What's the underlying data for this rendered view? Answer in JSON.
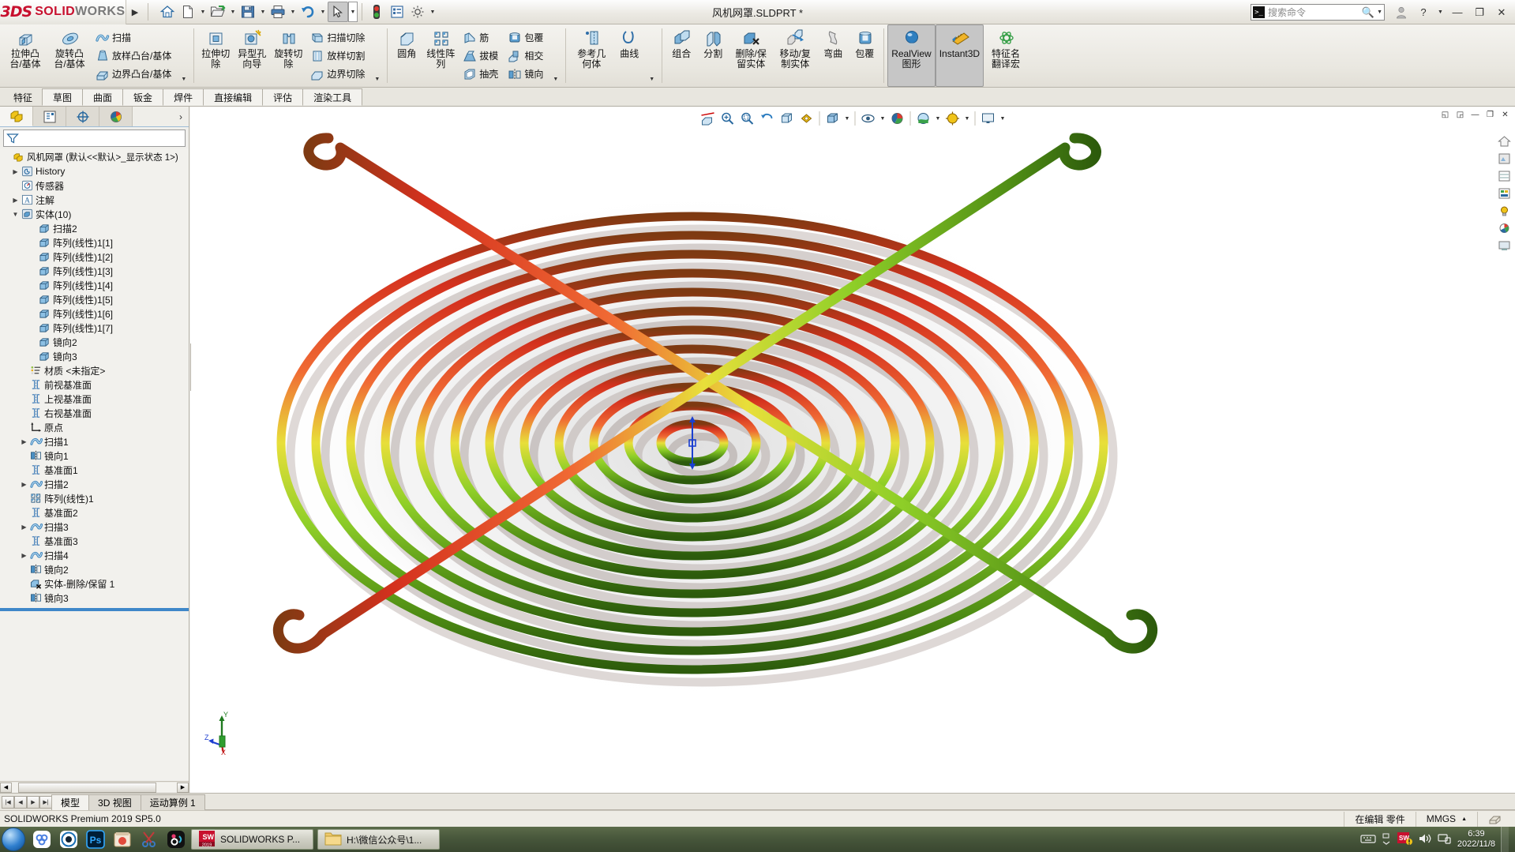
{
  "titlebar": {
    "logo_3ds": "3DS",
    "logo_solid": "SOLID",
    "logo_works": "WORKS",
    "document_title": "风机网罩.SLDPRT *",
    "quick_access": [
      {
        "name": "home-icon",
        "label": "主页"
      },
      {
        "name": "new-document-icon",
        "label": "新建"
      },
      {
        "name": "open-folder-icon",
        "label": "打开"
      },
      {
        "name": "save-icon",
        "label": "保存"
      },
      {
        "name": "print-icon",
        "label": "打印"
      },
      {
        "name": "undo-icon",
        "label": "撤销"
      },
      {
        "name": "select-cursor-icon",
        "label": "选择"
      },
      {
        "name": "rebuild-icon",
        "label": "重建模型"
      },
      {
        "name": "file-properties-icon",
        "label": "文件属性"
      },
      {
        "name": "options-gear-icon",
        "label": "选项"
      }
    ],
    "search": {
      "placeholder": "搜索命令",
      "icon": "search-icon"
    },
    "window_controls": {
      "account": "account-icon",
      "help": "?",
      "minimize": "—",
      "restore": "❐",
      "close": "✕"
    }
  },
  "ribbon": {
    "groups": [
      {
        "id": "boss",
        "big": [
          {
            "label": "拉伸凸\n台/基体",
            "icon": "extrude-boss-icon",
            "dropdown": false
          },
          {
            "label": "旋转凸\n台/基体",
            "icon": "revolve-boss-icon",
            "dropdown": false
          }
        ],
        "small": [
          {
            "label": "扫描",
            "icon": "sweep-icon"
          },
          {
            "label": "放样凸台/基体",
            "icon": "loft-boss-icon"
          },
          {
            "label": "边界凸台/基体",
            "icon": "boundary-boss-icon"
          }
        ],
        "has_drop": true
      },
      {
        "id": "cut",
        "big": [
          {
            "label": "拉伸切\n除",
            "icon": "extrude-cut-icon"
          },
          {
            "label": "异型孔\n向导",
            "icon": "hole-wizard-icon"
          },
          {
            "label": "旋转切\n除",
            "icon": "revolve-cut-icon"
          }
        ],
        "small": [
          {
            "label": "扫描切除",
            "icon": "sweep-cut-icon"
          },
          {
            "label": "放样切割",
            "icon": "loft-cut-icon"
          },
          {
            "label": "边界切除",
            "icon": "boundary-cut-icon"
          }
        ],
        "has_drop": true
      },
      {
        "id": "features",
        "big": [
          {
            "label": "圆角",
            "icon": "fillet-icon"
          },
          {
            "label": "线性阵\n列",
            "icon": "linear-pattern-icon"
          }
        ],
        "small": [
          {
            "label": "筋",
            "icon": "rib-icon"
          },
          {
            "label": "拔模",
            "icon": "draft-icon"
          },
          {
            "label": "抽壳",
            "icon": "shell-icon"
          },
          {
            "label": "包覆",
            "icon": "wrap-icon"
          },
          {
            "label": "相交",
            "icon": "intersect-icon"
          },
          {
            "label": "镜向",
            "icon": "mirror-icon"
          }
        ],
        "has_drop": true
      },
      {
        "id": "reference",
        "big": [
          {
            "label": "参考几\n何体",
            "icon": "reference-geometry-icon"
          },
          {
            "label": "曲线",
            "icon": "curves-icon"
          }
        ],
        "has_drop": true
      },
      {
        "id": "bodies",
        "big": [
          {
            "label": "组合",
            "icon": "combine-icon"
          },
          {
            "label": "分割",
            "icon": "split-icon"
          },
          {
            "label": "删除/保\n留实体",
            "icon": "delete-keep-body-icon"
          },
          {
            "label": "移动/复\n制实体",
            "icon": "move-copy-body-icon"
          },
          {
            "label": "弯曲",
            "icon": "flex-icon"
          },
          {
            "label": "包覆",
            "icon": "wrap2-icon"
          }
        ]
      },
      {
        "id": "display",
        "big": [
          {
            "label": "RealView\n图形",
            "icon": "realview-icon",
            "active": true
          },
          {
            "label": "Instant3D",
            "icon": "instant3d-icon",
            "active": true
          },
          {
            "label": "特征名\n翻译宏",
            "icon": "feature-translate-icon"
          }
        ]
      }
    ]
  },
  "command_tabs": [
    {
      "label": "特征",
      "selected": true
    },
    {
      "label": "草图",
      "selected": false
    },
    {
      "label": "曲面",
      "selected": false
    },
    {
      "label": "钣金",
      "selected": false
    },
    {
      "label": "焊件",
      "selected": false
    },
    {
      "label": "直接编辑",
      "selected": false
    },
    {
      "label": "评估",
      "selected": false
    },
    {
      "label": "渲染工具",
      "selected": false
    }
  ],
  "tree_panel": {
    "tabs": [
      {
        "name": "feature-manager-tab",
        "icon": "feature-tree-icon",
        "selected": true
      },
      {
        "name": "property-manager-tab",
        "icon": "property-manager-icon",
        "selected": false
      },
      {
        "name": "configuration-manager-tab",
        "icon": "configuration-icon",
        "selected": false
      },
      {
        "name": "display-manager-tab",
        "icon": "display-manager-icon",
        "selected": false
      }
    ],
    "more": "›",
    "filter": {
      "icon": "filter-icon",
      "placeholder": ""
    },
    "root": {
      "label": "风机网罩  (默认<<默认>_显示状态 1>)",
      "icon": "part-icon"
    },
    "nodes": [
      {
        "label": "History",
        "icon": "history-icon",
        "indent": 1,
        "expand": "collapsed"
      },
      {
        "label": "传感器",
        "icon": "sensor-icon",
        "indent": 1,
        "expand": "none"
      },
      {
        "label": "注解",
        "icon": "annotations-icon",
        "indent": 1,
        "expand": "collapsed"
      },
      {
        "label": "实体(10)",
        "icon": "solid-bodies-icon",
        "indent": 1,
        "expand": "expanded"
      },
      {
        "label": "扫描2",
        "icon": "body-icon",
        "indent": 3,
        "expand": "none"
      },
      {
        "label": "阵列(线性)1[1]",
        "icon": "body-icon",
        "indent": 3,
        "expand": "none"
      },
      {
        "label": "阵列(线性)1[2]",
        "icon": "body-icon",
        "indent": 3,
        "expand": "none"
      },
      {
        "label": "阵列(线性)1[3]",
        "icon": "body-icon",
        "indent": 3,
        "expand": "none"
      },
      {
        "label": "阵列(线性)1[4]",
        "icon": "body-icon",
        "indent": 3,
        "expand": "none"
      },
      {
        "label": "阵列(线性)1[5]",
        "icon": "body-icon",
        "indent": 3,
        "expand": "none"
      },
      {
        "label": "阵列(线性)1[6]",
        "icon": "body-icon",
        "indent": 3,
        "expand": "none"
      },
      {
        "label": "阵列(线性)1[7]",
        "icon": "body-icon",
        "indent": 3,
        "expand": "none"
      },
      {
        "label": "镜向2",
        "icon": "body-icon",
        "indent": 3,
        "expand": "none"
      },
      {
        "label": "镜向3",
        "icon": "body-icon",
        "indent": 3,
        "expand": "none"
      },
      {
        "label": "材质 <未指定>",
        "icon": "material-icon",
        "indent": 2,
        "expand": "none"
      },
      {
        "label": "前视基准面",
        "icon": "plane-icon",
        "indent": 2,
        "expand": "none"
      },
      {
        "label": "上视基准面",
        "icon": "plane-icon",
        "indent": 2,
        "expand": "none"
      },
      {
        "label": "右视基准面",
        "icon": "plane-icon",
        "indent": 2,
        "expand": "none"
      },
      {
        "label": "原点",
        "icon": "origin-icon",
        "indent": 2,
        "expand": "none"
      },
      {
        "label": "扫描1",
        "icon": "sweep-feature-icon",
        "indent": 2,
        "expand": "collapsed"
      },
      {
        "label": "镜向1",
        "icon": "mirror-feature-icon",
        "indent": 2,
        "expand": "none"
      },
      {
        "label": "基准面1",
        "icon": "plane-icon",
        "indent": 2,
        "expand": "none"
      },
      {
        "label": "扫描2",
        "icon": "sweep-feature-icon",
        "indent": 2,
        "expand": "collapsed"
      },
      {
        "label": "阵列(线性)1",
        "icon": "linear-pattern-feature-icon",
        "indent": 2,
        "expand": "none"
      },
      {
        "label": "基准面2",
        "icon": "plane-icon",
        "indent": 2,
        "expand": "none"
      },
      {
        "label": "扫描3",
        "icon": "sweep-feature-icon",
        "indent": 2,
        "expand": "collapsed"
      },
      {
        "label": "基准面3",
        "icon": "plane-icon",
        "indent": 2,
        "expand": "none"
      },
      {
        "label": "扫描4",
        "icon": "sweep-feature-icon",
        "indent": 2,
        "expand": "collapsed"
      },
      {
        "label": "镜向2",
        "icon": "mirror-feature-icon",
        "indent": 2,
        "expand": "none"
      },
      {
        "label": "实体-删除/保留 1",
        "icon": "delete-body-feature-icon",
        "indent": 2,
        "expand": "none"
      },
      {
        "label": "镜向3",
        "icon": "mirror-feature-icon",
        "indent": 2,
        "expand": "none"
      }
    ]
  },
  "viewport": {
    "toolbar": [
      {
        "name": "section-view-icon"
      },
      {
        "name": "zoom-to-fit-icon"
      },
      {
        "name": "zoom-to-area-icon"
      },
      {
        "name": "previous-view-icon"
      },
      {
        "name": "view-orientation-icon"
      },
      {
        "name": "view-settings-icon"
      },
      {
        "name": "display-style-icon",
        "dropdown": true
      },
      {
        "name": "hide-show-items-icon",
        "dropdown": true
      },
      {
        "name": "edit-appearance-icon"
      },
      {
        "name": "apply-scene-icon",
        "dropdown": true
      },
      {
        "name": "view-setting-icon",
        "dropdown": true
      },
      {
        "name": "viewport-layout-icon",
        "dropdown": true
      }
    ],
    "window_buttons": [
      "◱",
      "◲",
      "—",
      "❐",
      "✕"
    ],
    "right_rail": [
      {
        "name": "view-home-icon"
      },
      {
        "name": "appearance-icon"
      },
      {
        "name": "scene-icon"
      },
      {
        "name": "decal-icon"
      },
      {
        "name": "light-icon"
      },
      {
        "name": "camera-icon"
      },
      {
        "name": "walkthrough-icon"
      }
    ],
    "triad": {
      "x": "X",
      "y": "Y",
      "z": "Z"
    },
    "model_name": "风机网罩"
  },
  "document_tabs": {
    "nav": [
      "|◀",
      "◀",
      "▶",
      "▶|"
    ],
    "tabs": [
      {
        "label": "模型",
        "selected": true
      },
      {
        "label": "3D 视图",
        "selected": false
      },
      {
        "label": "运动算例 1",
        "selected": false
      }
    ]
  },
  "statusbar": {
    "left": "SOLIDWORKS Premium 2019 SP5.0",
    "edit_state": "在编辑 零件",
    "units": "MMGS",
    "units_arrow": "▲",
    "overlay_icon": "custom-icon"
  },
  "taskbar": {
    "start": "start-orb-icon",
    "pinned": [
      {
        "name": "app-icon-1",
        "label": ""
      },
      {
        "name": "app-icon-2",
        "label": ""
      },
      {
        "name": "photoshop-icon",
        "label": "Ps"
      },
      {
        "name": "app-icon-4",
        "label": ""
      },
      {
        "name": "snipping-tool-icon",
        "label": ""
      },
      {
        "name": "app-icon-6",
        "label": ""
      }
    ],
    "windows": [
      {
        "icon": "solidworks-taskbar-icon",
        "label": "SOLIDWORKS P...",
        "badge": "2019"
      },
      {
        "icon": "folder-icon",
        "label": "H:\\微信公众号\\1..."
      }
    ],
    "tray": [
      {
        "name": "keyboard-icon"
      },
      {
        "name": "tray-expand-icon"
      },
      {
        "name": "solidworks-tray-icon"
      },
      {
        "name": "volume-icon"
      },
      {
        "name": "network-icon"
      }
    ],
    "clock_time": "6:39",
    "clock_date": "2022/11/8"
  },
  "colors": {
    "accent_red": "#c8102e",
    "ribbon_bg": "#e9e7e0",
    "panel_bg": "#f0efeb",
    "highlight_blue": "#3f87c9",
    "model_red": "#d42a1e",
    "model_green": "#6eb821",
    "model_yellow": "#e8e23a"
  }
}
